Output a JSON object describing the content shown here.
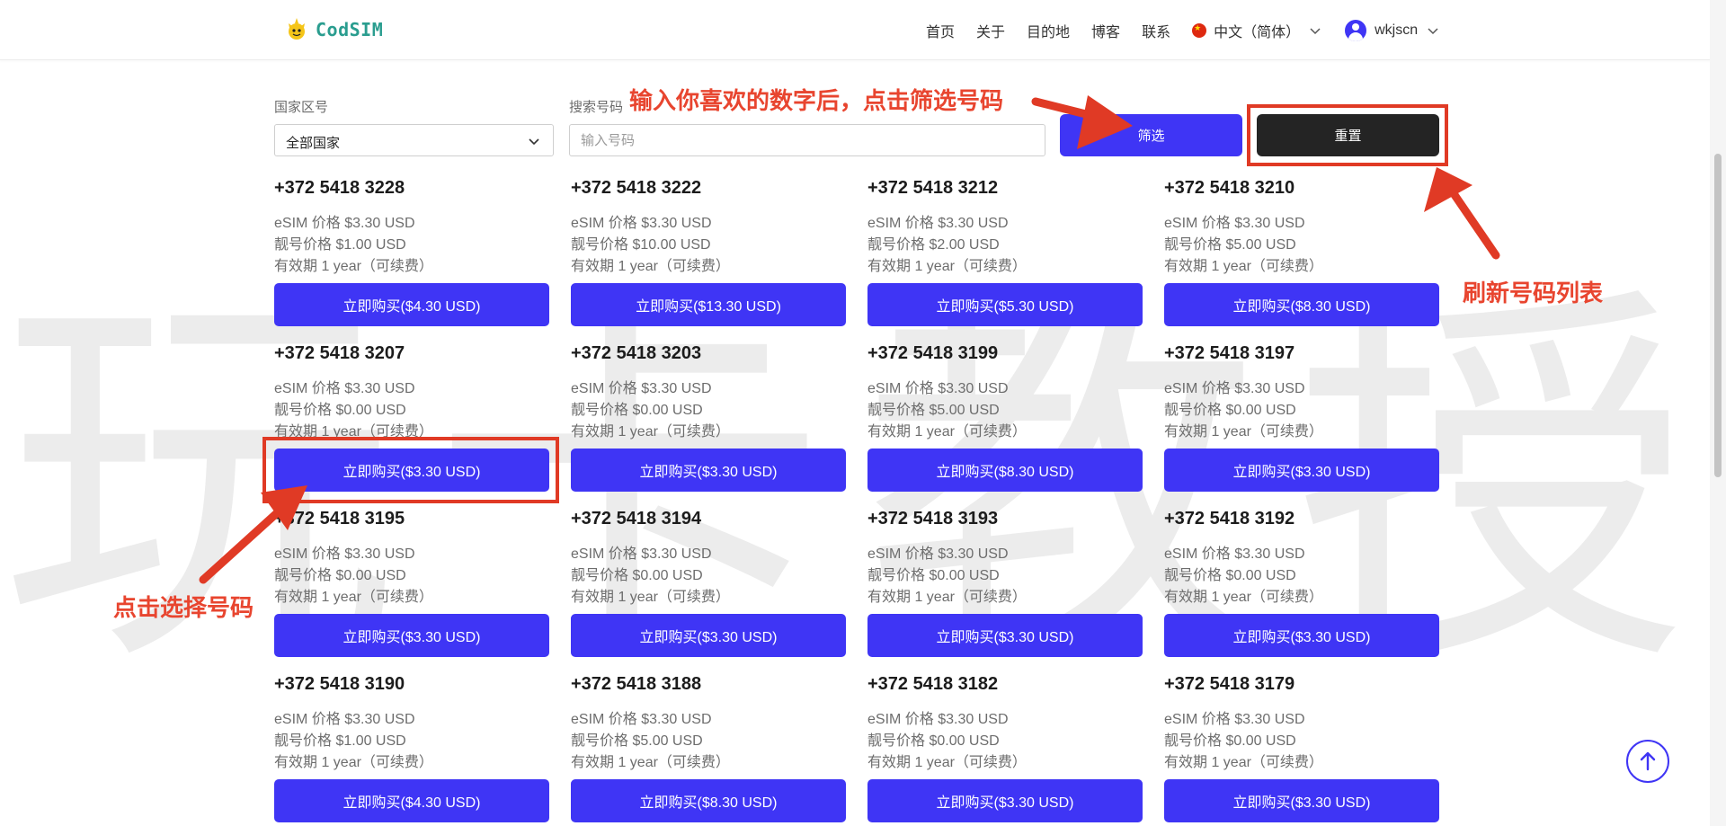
{
  "header": {
    "logo_text": "CodSIM",
    "nav": [
      "首页",
      "关于",
      "目的地",
      "博客",
      "联系"
    ],
    "language": "中文（简体）",
    "username": "wkjscn"
  },
  "filters": {
    "country_label": "国家区号",
    "country_value": "全部国家",
    "search_label": "搜索号码",
    "search_placeholder": "输入号码",
    "filter_button": "筛选",
    "reset_button": "重置"
  },
  "numbers": [
    {
      "phone": "+372 5418 3228",
      "esim": "eSIM 价格 $3.30 USD",
      "vanity": "靓号价格 $1.00 USD",
      "validity": "有效期 1 year（可续费）",
      "buy": "立即购买($4.30 USD)"
    },
    {
      "phone": "+372 5418 3222",
      "esim": "eSIM 价格 $3.30 USD",
      "vanity": "靓号价格 $10.00 USD",
      "validity": "有效期 1 year（可续费）",
      "buy": "立即购买($13.30 USD)"
    },
    {
      "phone": "+372 5418 3212",
      "esim": "eSIM 价格 $3.30 USD",
      "vanity": "靓号价格 $2.00 USD",
      "validity": "有效期 1 year（可续费）",
      "buy": "立即购买($5.30 USD)"
    },
    {
      "phone": "+372 5418 3210",
      "esim": "eSIM 价格 $3.30 USD",
      "vanity": "靓号价格 $5.00 USD",
      "validity": "有效期 1 year（可续费）",
      "buy": "立即购买($8.30 USD)"
    },
    {
      "phone": "+372 5418 3207",
      "esim": "eSIM 价格 $3.30 USD",
      "vanity": "靓号价格 $0.00 USD",
      "validity": "有效期 1 year（可续费）",
      "buy": "立即购买($3.30 USD)"
    },
    {
      "phone": "+372 5418 3203",
      "esim": "eSIM 价格 $3.30 USD",
      "vanity": "靓号价格 $0.00 USD",
      "validity": "有效期 1 year（可续费）",
      "buy": "立即购买($3.30 USD)"
    },
    {
      "phone": "+372 5418 3199",
      "esim": "eSIM 价格 $3.30 USD",
      "vanity": "靓号价格 $5.00 USD",
      "validity": "有效期 1 year（可续费）",
      "buy": "立即购买($8.30 USD)"
    },
    {
      "phone": "+372 5418 3197",
      "esim": "eSIM 价格 $3.30 USD",
      "vanity": "靓号价格 $0.00 USD",
      "validity": "有效期 1 year（可续费）",
      "buy": "立即购买($3.30 USD)"
    },
    {
      "phone": "+372 5418 3195",
      "esim": "eSIM 价格 $3.30 USD",
      "vanity": "靓号价格 $0.00 USD",
      "validity": "有效期 1 year（可续费）",
      "buy": "立即购买($3.30 USD)"
    },
    {
      "phone": "+372 5418 3194",
      "esim": "eSIM 价格 $3.30 USD",
      "vanity": "靓号价格 $0.00 USD",
      "validity": "有效期 1 year（可续费）",
      "buy": "立即购买($3.30 USD)"
    },
    {
      "phone": "+372 5418 3193",
      "esim": "eSIM 价格 $3.30 USD",
      "vanity": "靓号价格 $0.00 USD",
      "validity": "有效期 1 year（可续费）",
      "buy": "立即购买($3.30 USD)"
    },
    {
      "phone": "+372 5418 3192",
      "esim": "eSIM 价格 $3.30 USD",
      "vanity": "靓号价格 $0.00 USD",
      "validity": "有效期 1 year（可续费）",
      "buy": "立即购买($3.30 USD)"
    },
    {
      "phone": "+372 5418 3190",
      "esim": "eSIM 价格 $3.30 USD",
      "vanity": "靓号价格 $1.00 USD",
      "validity": "有效期 1 year（可续费）",
      "buy": "立即购买($4.30 USD)"
    },
    {
      "phone": "+372 5418 3188",
      "esim": "eSIM 价格 $3.30 USD",
      "vanity": "靓号价格 $5.00 USD",
      "validity": "有效期 1 year（可续费）",
      "buy": "立即购买($8.30 USD)"
    },
    {
      "phone": "+372 5418 3182",
      "esim": "eSIM 价格 $3.30 USD",
      "vanity": "靓号价格 $0.00 USD",
      "validity": "有效期 1 year（可续费）",
      "buy": "立即购买($3.30 USD)"
    },
    {
      "phone": "+372 5418 3179",
      "esim": "eSIM 价格 $3.30 USD",
      "vanity": "靓号价格 $0.00 USD",
      "validity": "有效期 1 year（可续费）",
      "buy": "立即购买($3.30 USD)"
    }
  ],
  "annotations": {
    "filter_hint": "输入你喜欢的数字后，点击筛选号码",
    "refresh_hint": "刷新号码列表",
    "select_hint": "点击选择号码",
    "color": "#e8452f"
  },
  "watermark": "玩卡教授",
  "colors": {
    "accent": "#3f35f5",
    "reset_button": "#242424"
  }
}
